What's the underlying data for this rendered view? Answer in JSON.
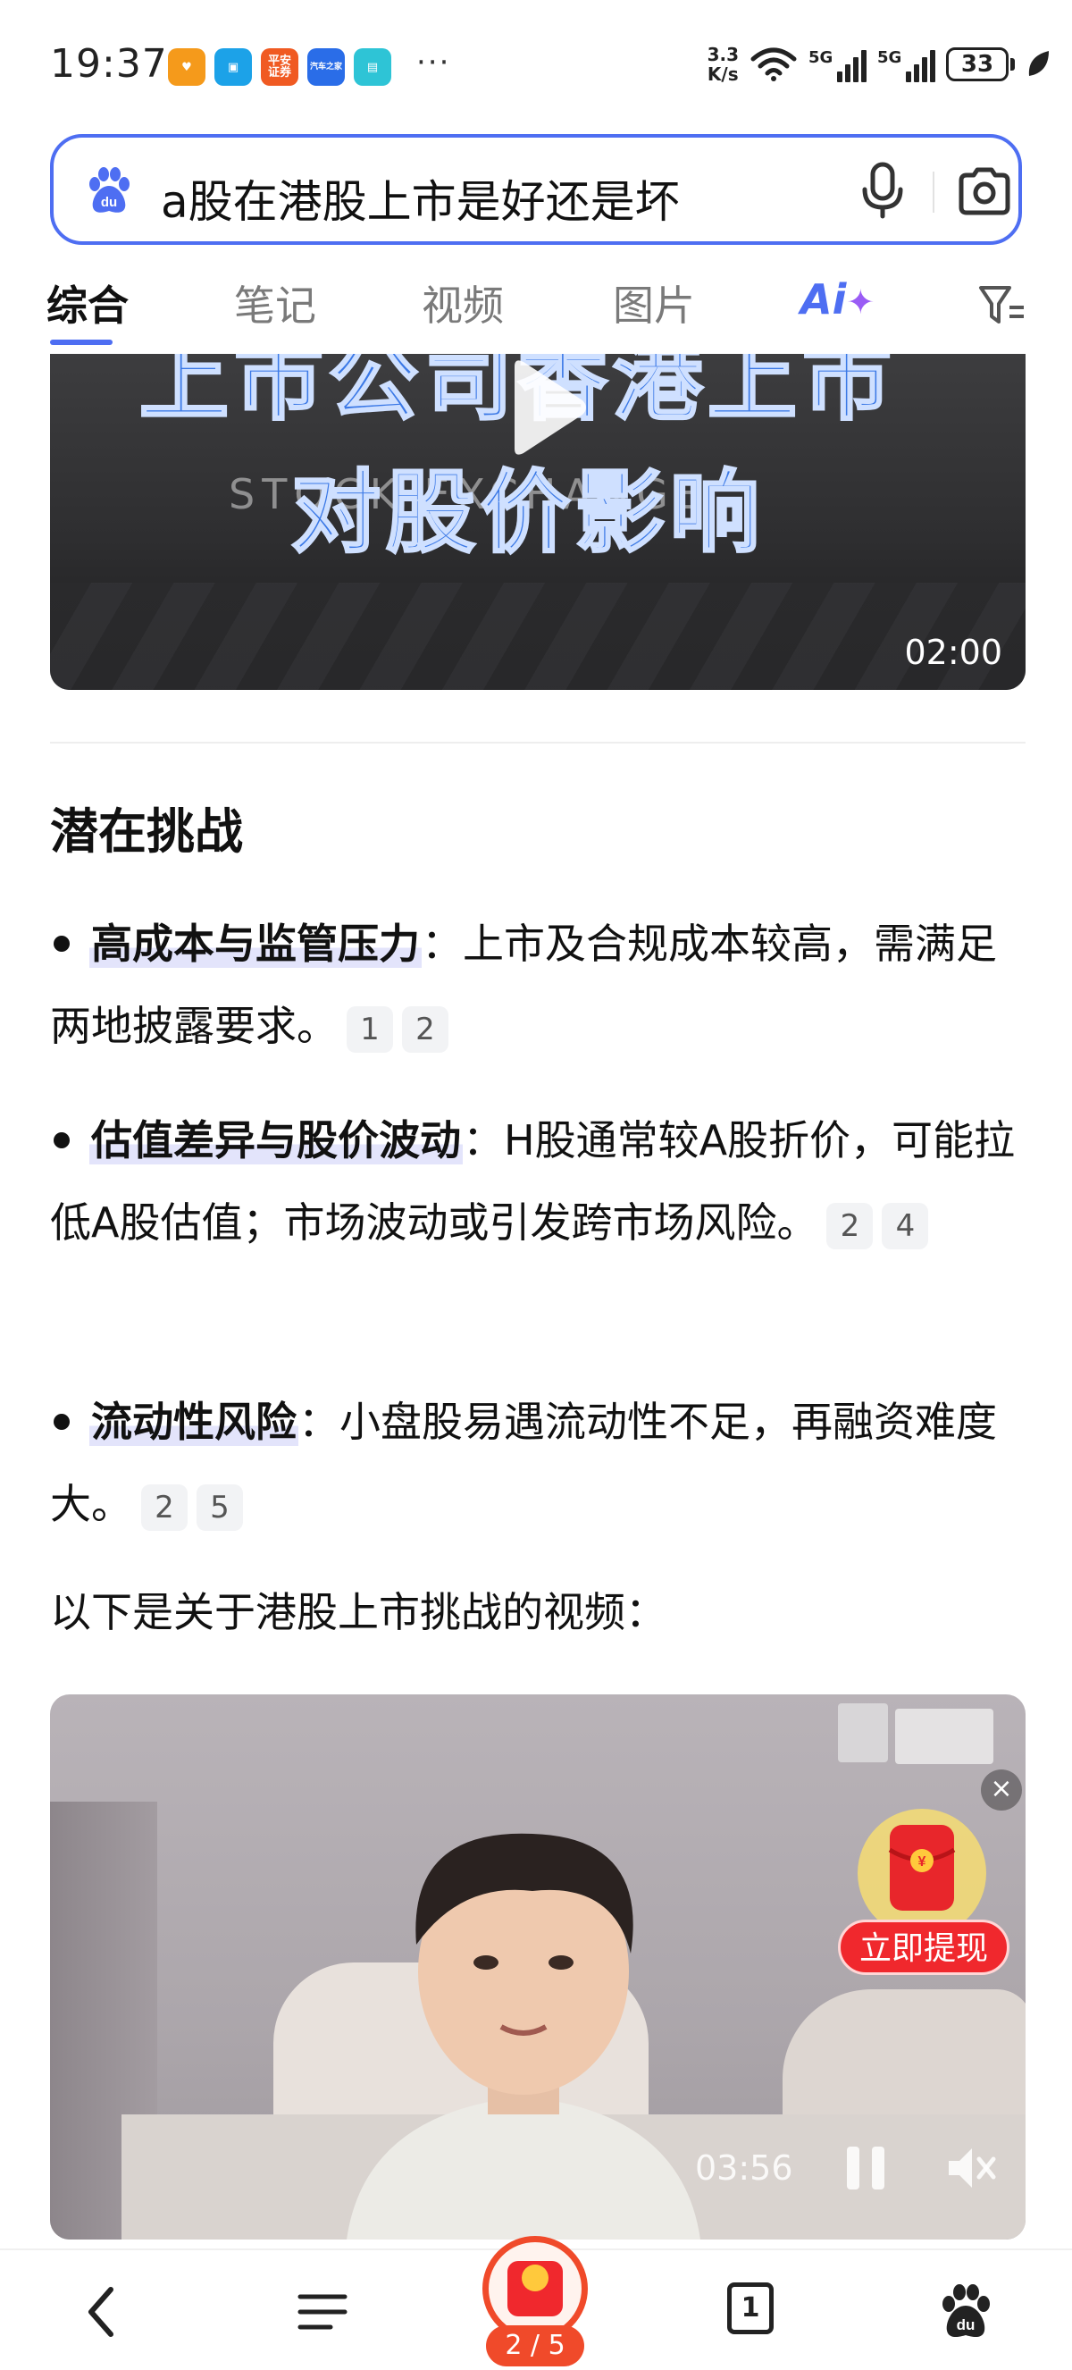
{
  "status_bar": {
    "time": "19:37",
    "more": "···",
    "net_speed_value": "3.3",
    "net_speed_unit": "K/s",
    "signal_1_label": "5G",
    "signal_2_label": "5G",
    "battery": "33",
    "app_icons": [
      "alipay-heart-icon",
      "shopping-bag-icon",
      "ping-an-securities-icon",
      "autohome-icon",
      "reader-book-icon"
    ],
    "app_labels": [
      "",
      "",
      "平安\n证券",
      "汽车之家",
      ""
    ]
  },
  "search": {
    "query": "a股在港股上市是好还是坏"
  },
  "tabs": {
    "items": [
      "综合",
      "笔记",
      "视频",
      "图片"
    ],
    "ai_label": "Ai",
    "ai_spark": "✦",
    "active_index": 0
  },
  "video1": {
    "title_line1": "上市公司香港上市",
    "title_line2": "对股价影响",
    "background_text": "STOCK EXCHANGE",
    "duration": "02:00"
  },
  "section": {
    "heading": "潜在挑战",
    "bullets": [
      {
        "term": "高成本与监管压力",
        "colon": "：",
        "text": "上市及合规成本较高，需满足两地披露要求。",
        "citations": [
          "1",
          "2"
        ]
      },
      {
        "term": "估值差异与股价波动",
        "colon": "：",
        "text": "H股通常较A股折价，可能拉低A股估值；市场波动或引发跨市场风险。",
        "citations": [
          "2",
          "4"
        ]
      },
      {
        "term": "流动性风险",
        "colon": "：",
        "text": "小盘股易遇流动性不足，再融资难度大。",
        "citations": [
          "2",
          "5"
        ]
      }
    ],
    "video_intro": "以下是关于港股上市挑战的视频："
  },
  "video2": {
    "duration": "03:56"
  },
  "floating_promo": {
    "close": "×",
    "button": "立即提现"
  },
  "bottom_nav": {
    "reward_counter": "2 / 5",
    "tab_count": "1"
  },
  "colors": {
    "accent": "#4e6ef2",
    "highlight": "#e3e4fb",
    "promo_red": "#f0282d"
  }
}
